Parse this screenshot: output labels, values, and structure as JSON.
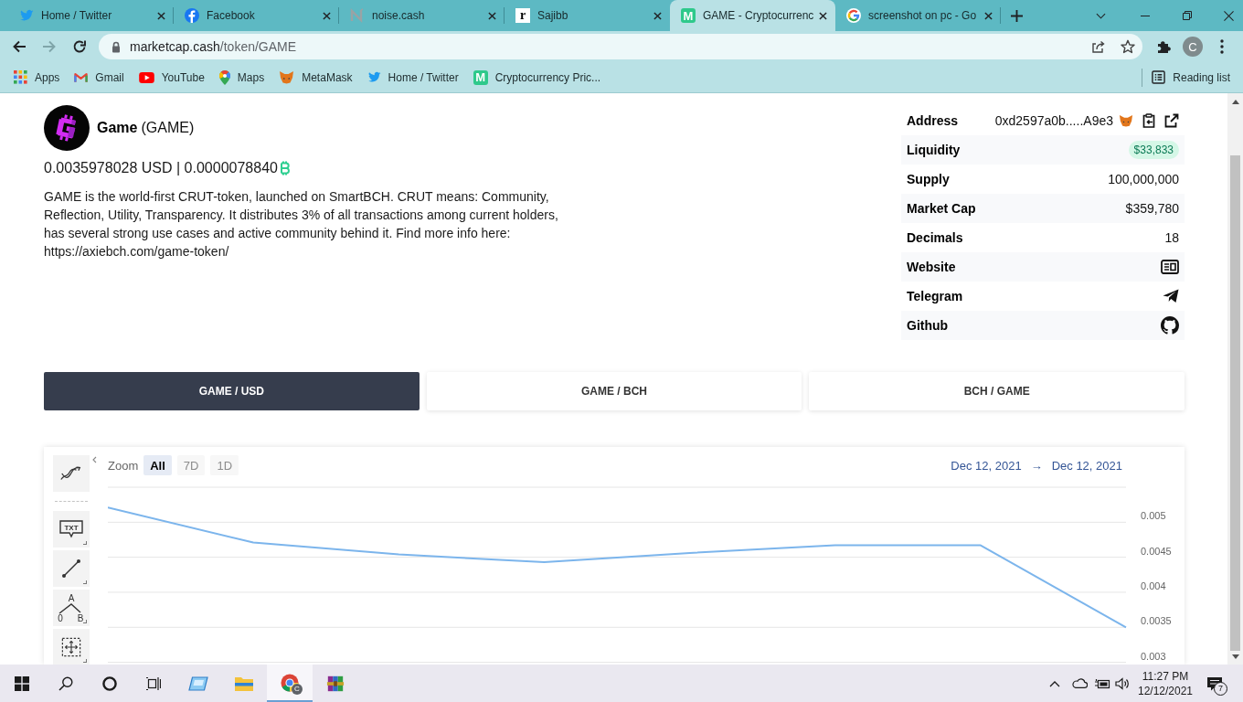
{
  "browser": {
    "tabs": [
      {
        "title": "Home / Twitter",
        "kind": "twitter",
        "selected": false
      },
      {
        "title": "Facebook",
        "kind": "facebook",
        "selected": false
      },
      {
        "title": "noise.cash",
        "kind": "noise",
        "selected": false
      },
      {
        "title": "Sajibb",
        "kind": "letter-light",
        "tile_text": "r",
        "selected": false
      },
      {
        "title": "GAME - Cryptocurrenc",
        "kind": "letter-green",
        "tile_text": "M",
        "selected": true
      },
      {
        "title": "screenshot on pc - Go",
        "kind": "google",
        "selected": false
      }
    ],
    "forward_disabled": true,
    "address": {
      "host": "marketcap.cash",
      "path": "/token/GAME"
    },
    "profile_initial": "C",
    "bookmarks": [
      {
        "label": "Apps",
        "kind": "apps"
      },
      {
        "label": "Gmail",
        "kind": "gmail"
      },
      {
        "label": "YouTube",
        "kind": "youtube"
      },
      {
        "label": "Maps",
        "kind": "maps"
      },
      {
        "label": "MetaMask",
        "kind": "fox"
      },
      {
        "label": "Home / Twitter",
        "kind": "twitter"
      },
      {
        "label": "Cryptocurrency Pric...",
        "kind": "letter-green",
        "tile_text": "M"
      }
    ],
    "reading_list": "Reading list"
  },
  "token": {
    "name": "Game",
    "symbol": "(GAME)",
    "price": "0.0035978028 USD | 0.0000078840",
    "description": "GAME is the world-first CRUT-token, launched on SmartBCH. CRUT means: Community, Reflection, Utility, Transparency. It distributes 3% of all transactions among current holders, has several strong use cases and active community behind it. Find more info here: https://axiebch.com/game-token/"
  },
  "details": [
    {
      "label": "Address",
      "kind": "address",
      "value": "0xd2597a0b.....A9e3"
    },
    {
      "label": "Liquidity",
      "kind": "badge",
      "value": "$33,833"
    },
    {
      "label": "Supply",
      "kind": "text",
      "value": "100,000,000"
    },
    {
      "label": "Market Cap",
      "kind": "text",
      "value": "$359,780"
    },
    {
      "label": "Decimals",
      "kind": "text",
      "value": "18"
    },
    {
      "label": "Website",
      "kind": "website"
    },
    {
      "label": "Telegram",
      "kind": "telegram"
    },
    {
      "label": "Github",
      "kind": "github"
    }
  ],
  "pairs": [
    {
      "label": "GAME / USD",
      "selected": true
    },
    {
      "label": "GAME / BCH",
      "selected": false
    },
    {
      "label": "BCH / GAME",
      "selected": false
    }
  ],
  "chart": {
    "tools": [
      {
        "kind": "trend"
      },
      {
        "kind": "text",
        "text": "TXT"
      },
      {
        "kind": "segment"
      },
      {
        "kind": "pattern",
        "points": [
          "A",
          "0",
          "B"
        ]
      },
      {
        "kind": "measure"
      }
    ],
    "zoom_label": "Zoom",
    "zoom_buttons": [
      {
        "label": "All",
        "selected": true,
        "disabled": false
      },
      {
        "label": "7D",
        "selected": false,
        "disabled": true
      },
      {
        "label": "1D",
        "selected": false,
        "disabled": true
      }
    ],
    "date_from": "Dec 12, 2021",
    "date_arrow": "→",
    "date_to": "Dec 12, 2021",
    "chart_data": {
      "type": "line",
      "grid": true,
      "series": [
        {
          "color": "#7cb5ec",
          "values": [
            0.00521,
            0.00471,
            0.00454,
            0.00443,
            0.00456,
            0.00467,
            0.00467,
            0.0035
          ]
        }
      ],
      "ylim": [
        0.003,
        0.0055
      ],
      "yticks": [
        0.003,
        0.0035,
        0.004,
        0.0045,
        0.005
      ]
    }
  },
  "taskbar": {
    "apps": [
      {
        "kind": "start",
        "selected": false
      },
      {
        "kind": "search",
        "selected": false
      },
      {
        "kind": "cortana",
        "selected": false
      },
      {
        "kind": "task-view",
        "selected": false
      },
      {
        "kind": "blue-app",
        "selected": false
      },
      {
        "kind": "folder",
        "selected": false
      },
      {
        "kind": "chrome",
        "selected": true,
        "badge": "C"
      },
      {
        "kind": "winrar",
        "selected": false
      }
    ],
    "time": "11:27 PM",
    "date": "12/12/2021",
    "notifications": "7"
  }
}
